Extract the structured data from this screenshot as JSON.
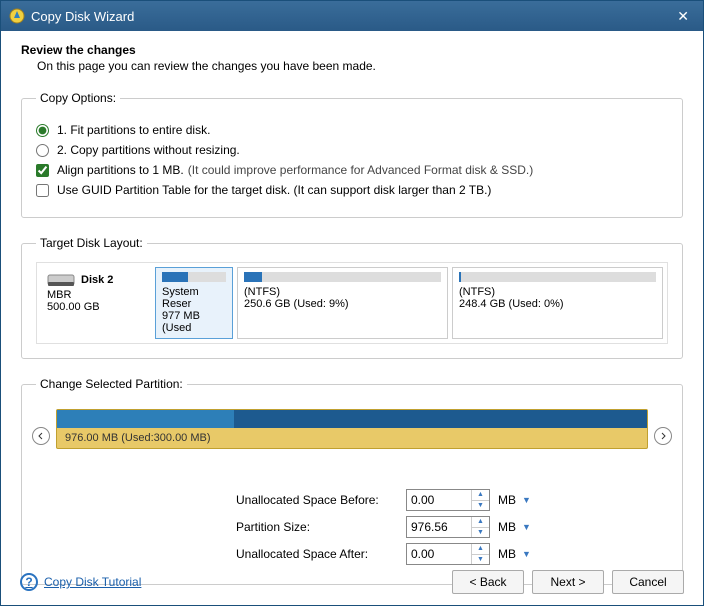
{
  "window": {
    "title": "Copy Disk Wizard"
  },
  "header": {
    "heading": "Review the changes",
    "sub": "On this page you can review the changes you have been made."
  },
  "copy_options": {
    "legend": "Copy Options:",
    "opt1": "1. Fit partitions to entire disk.",
    "opt2": "2. Copy partitions without resizing.",
    "align_label": "Align partitions to 1 MB.",
    "align_extra": "(It could improve performance for Advanced Format disk & SSD.)",
    "guid_label": "Use GUID Partition Table for the target disk. (It can support disk larger than 2 TB.)"
  },
  "target_layout": {
    "legend": "Target Disk Layout:",
    "disk": {
      "name": "Disk 2",
      "type": "MBR",
      "size": "500.00 GB"
    },
    "partitions": [
      {
        "name": "System Reser",
        "size": "977 MB (Used",
        "fillpct": 40
      },
      {
        "name": "(NTFS)",
        "size": "250.6 GB (Used: 9%)",
        "fillpct": 9
      },
      {
        "name": "(NTFS)",
        "size": "248.4 GB (Used: 0%)",
        "fillpct": 1
      }
    ]
  },
  "change": {
    "legend": "Change Selected Partition:",
    "bar_label": "976.00 MB (Used:300.00 MB)"
  },
  "params": {
    "before_label": "Unallocated Space Before:",
    "before_val": "0.00",
    "size_label": "Partition Size:",
    "size_val": "976.56",
    "after_label": "Unallocated Space After:",
    "after_val": "0.00",
    "unit": "MB"
  },
  "footer": {
    "help": "Copy Disk Tutorial",
    "back": "< Back",
    "next": "Next >",
    "cancel": "Cancel"
  }
}
